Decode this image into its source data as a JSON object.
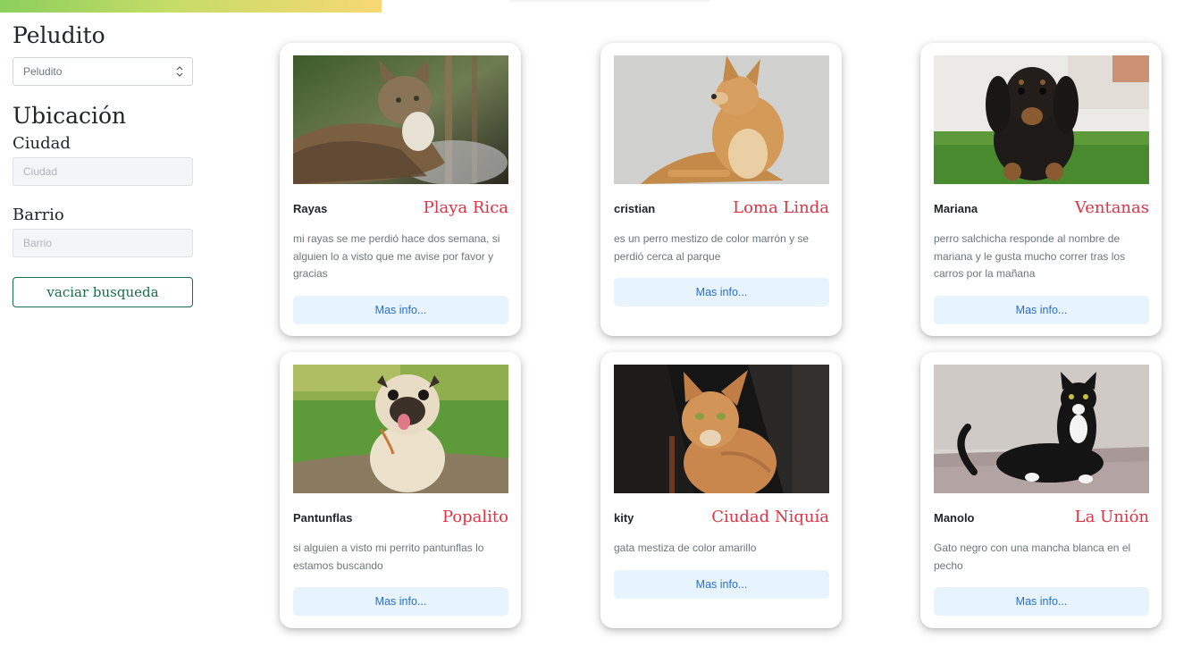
{
  "sidebar": {
    "title": "Peludito",
    "select_value": "Peludito",
    "location_heading": "Ubicación",
    "city_label": "Ciudad",
    "city_placeholder": "Ciudad",
    "barrio_label": "Barrio",
    "barrio_placeholder": "Barrio",
    "clear_button": "vaciar busqueda"
  },
  "cards": [
    {
      "name": "Rayas",
      "place": "Playa Rica",
      "description": "mi rayas se me perdió hace dos semana, si alguien lo a visto que me avise por favor y gracias",
      "button": "Mas info...",
      "photo": "cat-photo"
    },
    {
      "name": "cristian",
      "place": "Loma Linda",
      "description": "es un perro mestizo de color marrón y se perdió cerca al parque",
      "button": "Mas info...",
      "photo": "dog-photo"
    },
    {
      "name": "Mariana",
      "place": "Ventanas",
      "description": "perro salchicha responde al nombre de mariana y le gusta mucho correr tras los carros por la mañana",
      "button": "Mas info...",
      "photo": "dachshund-photo"
    },
    {
      "name": "Pantunflas",
      "place": "Popalito",
      "description": "si alguien a visto mi perrito pantunflas lo estamos buscando",
      "button": "Mas info...",
      "photo": "pug-photo"
    },
    {
      "name": "kity",
      "place": "Ciudad Niquía",
      "description": "gata mestiza de color amarillo",
      "button": "Mas info...",
      "photo": "orange-cat-photo"
    },
    {
      "name": "Manolo",
      "place": "La Unión",
      "description": "Gato negro con una mancha blanca en el pecho",
      "button": "Mas info...",
      "photo": "tuxedo-cat-photo"
    }
  ],
  "colors": {
    "place": "#dc3545",
    "button_bg": "#e7f3fd",
    "button_text": "#2a6fc9",
    "clear_border": "#1a6b4b"
  }
}
